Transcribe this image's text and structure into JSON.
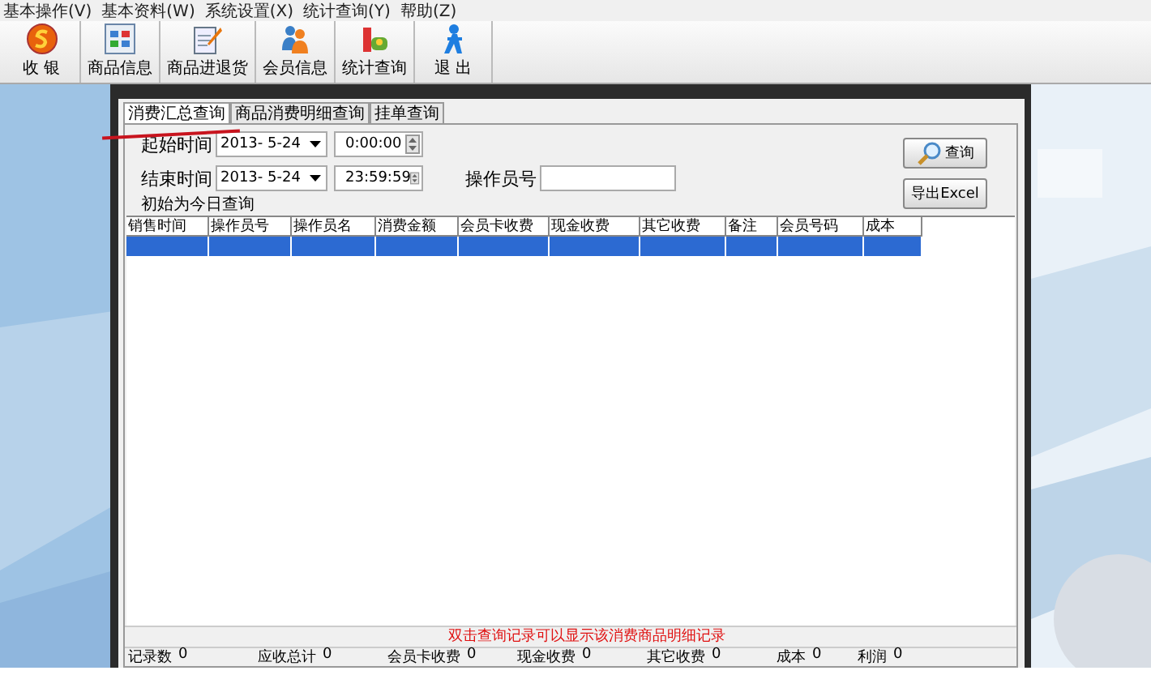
{
  "menu": [
    "基本操作(V)",
    "基本资料(W)",
    "系统设置(X)",
    "统计查询(Y)",
    "帮助(Z)"
  ],
  "toolbar": [
    {
      "kind": "coin",
      "label": "收 银"
    },
    {
      "kind": "grid",
      "label": "商品信息"
    },
    {
      "kind": "notepad",
      "label": "商品进退货"
    },
    {
      "kind": "people",
      "label": "会员信息"
    },
    {
      "kind": "stats",
      "label": "统计查询"
    },
    {
      "kind": "exit",
      "label": "退 出"
    }
  ],
  "tabs": [
    {
      "label": "消费汇总查询",
      "selected": true
    },
    {
      "label": "商品消费明细查询",
      "selected": false
    },
    {
      "label": "挂单查询",
      "selected": false
    }
  ],
  "form": {
    "start_label": "起始时间",
    "start_date": "2013- 5-24",
    "start_time": "0:00:00",
    "end_label": "结束时间",
    "end_date": "2013- 5-24",
    "end_time": "23:59:59",
    "operator_label": "操作员号",
    "note": "初始为今日查询"
  },
  "buttons": [
    {
      "kind": "search",
      "label": "查询"
    },
    {
      "kind": "export",
      "label": "导出Excel"
    }
  ],
  "table": {
    "columns": [
      "销售时间",
      "操作员号",
      "操作员名",
      "消费金额",
      "会员卡收费",
      "现金收费",
      "其它收费",
      "备注",
      "会员号码",
      "成本"
    ],
    "rows": [
      {
        "selected": true
      }
    ]
  },
  "hint": "双击查询记录可以显示该消费商品明细记录",
  "status_bar": [
    {
      "label": "记录数",
      "value": "0"
    },
    {
      "label": "应收总计",
      "value": "0"
    },
    {
      "label": "会员卡收费",
      "value": "0"
    },
    {
      "label": "现金收费",
      "value": "0"
    },
    {
      "label": "其它收费",
      "value": "0"
    },
    {
      "label": "成本",
      "value": "0"
    },
    {
      "label": "利润",
      "value": "0"
    }
  ]
}
